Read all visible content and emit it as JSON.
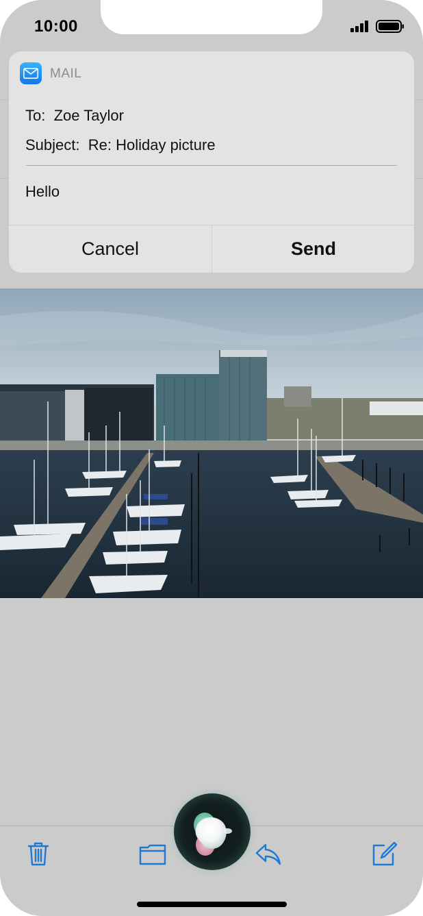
{
  "status_bar": {
    "time": "10:00",
    "icons": [
      "cellular-signal-icon",
      "battery-icon"
    ]
  },
  "siri_card": {
    "app_name": "MAIL",
    "app_icon": "mail-icon",
    "to_label": "To:",
    "to_value": "Zoe Taylor",
    "subject_label": "Subject:",
    "subject_value": "Re: Holiday picture",
    "body": "Hello",
    "cancel_label": "Cancel",
    "send_label": "Send"
  },
  "toolbar": {
    "items": [
      {
        "icon": "trash-icon"
      },
      {
        "icon": "folder-icon"
      },
      {
        "icon": "reply-icon"
      },
      {
        "icon": "compose-icon"
      }
    ],
    "color": "#1f78d1"
  },
  "colors": {
    "accent": "#1f78d1",
    "card_bg": "#e3e3e3",
    "dim_bg": "#cbcbcb"
  }
}
